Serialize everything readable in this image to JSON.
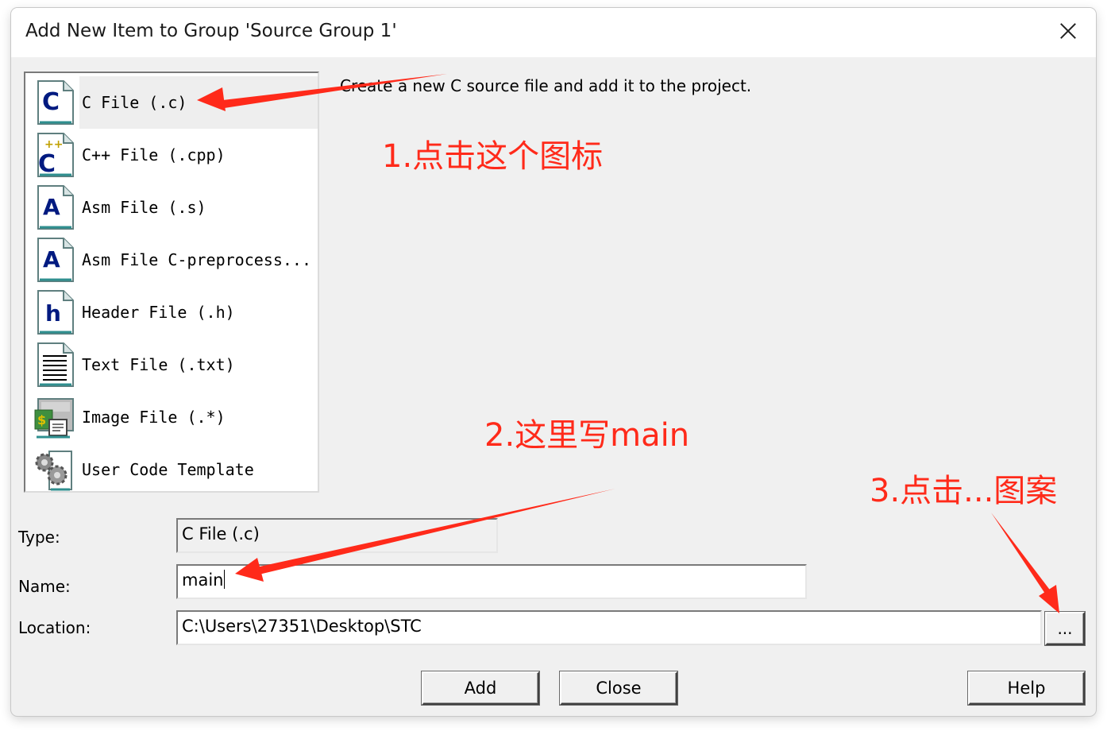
{
  "dialog": {
    "title": "Add New Item to Group 'Source Group 1'",
    "close_glyph": "✕"
  },
  "items": [
    {
      "label": "C File (.c)",
      "icon": "c-file-icon",
      "selected": true
    },
    {
      "label": "C++ File (.cpp)",
      "icon": "cpp-file-icon",
      "selected": false
    },
    {
      "label": "Asm File (.s)",
      "icon": "asm-file-icon",
      "selected": false
    },
    {
      "label": "Asm File C-preprocess...",
      "icon": "asm-preprocess-file-icon",
      "selected": false
    },
    {
      "label": "Header File (.h)",
      "icon": "header-file-icon",
      "selected": false
    },
    {
      "label": "Text File (.txt)",
      "icon": "text-file-icon",
      "selected": false
    },
    {
      "label": "Image File (.*)",
      "icon": "image-file-icon",
      "selected": false
    },
    {
      "label": "User Code Template",
      "icon": "gears-icon",
      "selected": false
    }
  ],
  "description": "Create a new C source file and add it to the project.",
  "form": {
    "type_label": "Type:",
    "type_value": "C File (.c)",
    "name_label": "Name:",
    "name_value": "main",
    "location_label": "Location:",
    "location_value": "C:\\Users\\27351\\Desktop\\STC",
    "browse_label": "..."
  },
  "buttons": {
    "add": "Add",
    "close": "Close",
    "help": "Help"
  },
  "annotations": {
    "step1": "1.点击这个图标",
    "step2": "2.这里写main",
    "step3": "3.点击...图案",
    "color": "#ff2a1a"
  }
}
